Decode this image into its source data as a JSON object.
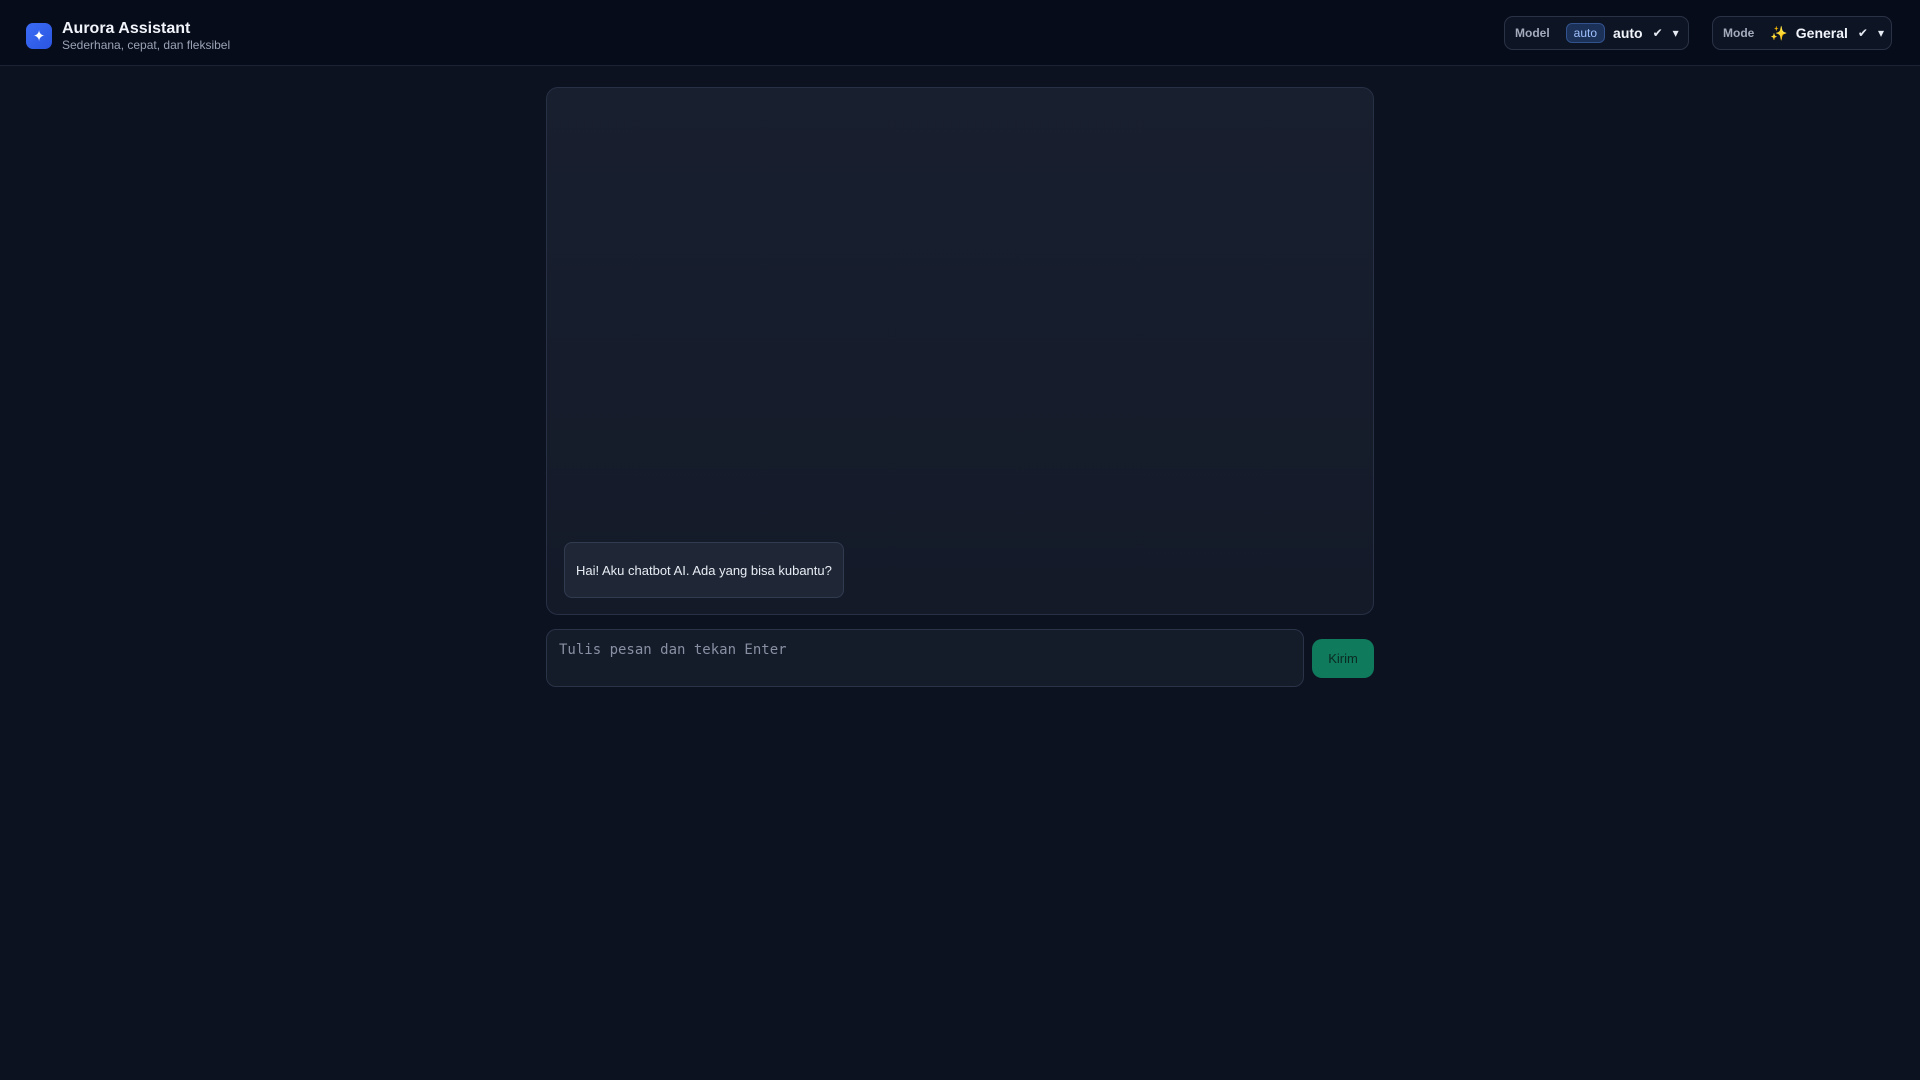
{
  "header": {
    "brand_icon": "sparkle-icon",
    "title": "Aurora Assistant",
    "subtitle": "Sederhana, cepat, dan fleksibel"
  },
  "model_selector": {
    "label": "Model",
    "badge": "auto",
    "value": "auto",
    "check": "✔",
    "chevron": "▾"
  },
  "mode_selector": {
    "label": "Mode",
    "emoji": "✨",
    "value": "General",
    "check": "✔",
    "chevron": "▾"
  },
  "chat": {
    "messages": [
      {
        "role": "assistant",
        "text": "Hai! Aku chatbot AI. Ada yang bisa kubantu?"
      }
    ]
  },
  "composer": {
    "placeholder": "Tulis pesan dan tekan Enter",
    "value": "",
    "send_label": "Kirim"
  },
  "colors": {
    "accent": "#3b6cf6",
    "send": "#0f7a5c",
    "background": "#0c1220"
  }
}
